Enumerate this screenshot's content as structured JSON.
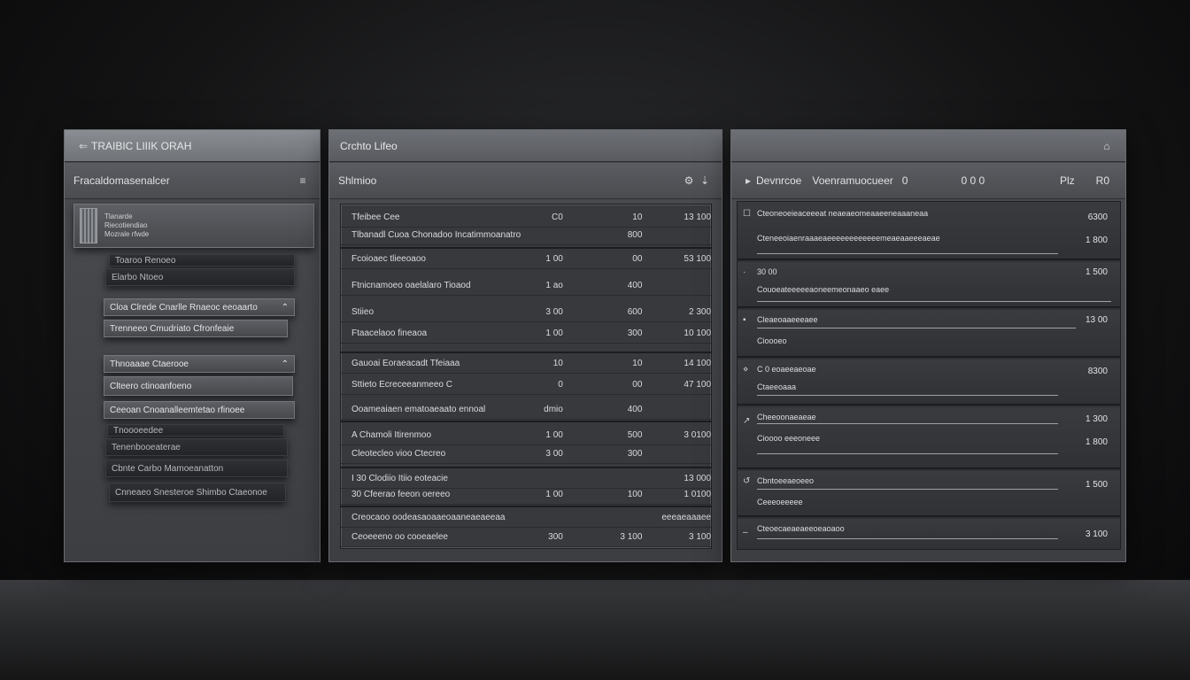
{
  "left": {
    "title": "TRAIBIC LIIIK ORAH",
    "header": "Fracaldomasenalcer",
    "cards": [
      {
        "l1": "Tlanarde",
        "l2": "Riecotiendiao",
        "l3": "Mozrale rfwde"
      },
      {
        "label": "Toaroo Renoeo"
      },
      {
        "label": "Elarbo Ntoeo"
      },
      {
        "label": "Cloa Clrede Cnarlle Rnaeoc eeoaarto"
      },
      {
        "label": "Trenneeo Cmudriato Cfronfeaie"
      },
      {
        "label": "Thnoaaae Ctaerooe"
      },
      {
        "label": "Clteero ctinoanfoeno"
      },
      {
        "label": "Ceeoan Cnoanalleemtetao rfinoee"
      },
      {
        "label": "Tnoooeedee"
      },
      {
        "label": "Tenenbooeaterae"
      },
      {
        "label": "Cbnte Carbo Mamoeanatton"
      },
      {
        "label": "Cnneaeo Snesteroe Shimbo Ctaeonoe"
      }
    ]
  },
  "mid": {
    "title": "Crchto Lifeo",
    "header": "Shlmioo",
    "groups": [
      {
        "rows": [
          {
            "a": "Tfeibee Cee",
            "b": "C0",
            "c": "10",
            "d": "13 100"
          },
          {
            "a": "Tlbanadl Cuoa Chonadoo Incatimmoanatro",
            "b": "",
            "c": "800",
            "d": ""
          }
        ]
      },
      {
        "rows": [
          {
            "a": "Fcoioaec tlieeoaoo",
            "b": "1 00",
            "c": "00",
            "d": "53 100"
          },
          {
            "a": "Ftnicnamoeo oaelalaro Tioaod",
            "b": "1 ao",
            "c": "400",
            "d": ""
          },
          {
            "a": "Stiieo",
            "b": "3 00",
            "c": "600",
            "d": "2 300"
          },
          {
            "a": "Ftaacelaoo fineaoa",
            "b": "1 00",
            "c": "300",
            "d": "10 100"
          }
        ]
      },
      {
        "rows": [
          {
            "a": "Gauoai Eoraeacadt Tfeiaaa",
            "b": "10",
            "c": "10",
            "d": "14 100"
          },
          {
            "a": "Sttieto Ecreceeanmeeo C",
            "b": "0",
            "c": "00",
            "d": "47 100"
          },
          {
            "a": "Ooameaiaen ematoaeaato ennoal",
            "b": "dmio",
            "c": "400",
            "d": ""
          }
        ]
      },
      {
        "rows": [
          {
            "a": "A Chamoli Itirenmoo",
            "b": "1 00",
            "c": "500",
            "d": "3 0100"
          },
          {
            "a": "Cleotecleo vioo Ctecreo",
            "b": "3 00",
            "c": "300",
            "d": ""
          }
        ]
      },
      {
        "rows": [
          {
            "a": "I 30 Clodiio Itiio eoteacie",
            "b": "",
            "c": "",
            "d": "13 000"
          },
          {
            "a": "30 Cfeerao feeon oereeo",
            "b": "1 00",
            "c": "100",
            "d": "1 0100"
          }
        ]
      },
      {
        "rows": [
          {
            "a": "Creocaoo oodeasaoaaeoaaneaeaeeaa",
            "b": "",
            "c": "",
            "d": "eeeaeaaaee"
          },
          {
            "a": "Ceoeeeno oo cooeaelee",
            "b": "300",
            "c": "3 100",
            "d": "3 100"
          }
        ]
      }
    ]
  },
  "right": {
    "header_items": [
      "Devnrcoe",
      "Voenramuocueer",
      "0",
      "0 0 0",
      "Plz",
      "R0"
    ],
    "items": [
      {
        "title": "Cteoneoeieaceeeat neaeaeomeaaeeneaaaneaa",
        "sub": "Cteneeoiaenraaaeaeeeeeeeeeeeemeaeaaeeeaeae",
        "v1": "6300",
        "v2": "1 800"
      },
      {
        "title": "30 00",
        "sub": "Couoeateeeeeaoneemeonaaeo eaee",
        "v1": "1 500",
        "v2": ""
      },
      {
        "title": "Cleaeoaaeeeaee",
        "sub": "Cioooeo",
        "v1": "13 00",
        "v2": ""
      },
      {
        "title": "C 0 eoaeeaeoae",
        "sub": "Ctaeeoaaa",
        "v1": "8300",
        "v2": ""
      },
      {
        "title": "Cheeoonaeaeae",
        "sub": "Cioooo eeeoneee",
        "v1": "1 300",
        "v2": "1 800"
      },
      {
        "title": "Cbntoeeaeoeeo",
        "sub": "Ceeeoeeeee",
        "v1": "1 500",
        "v2": ""
      },
      {
        "title": "Cteoecaeaeaeeoeaoaoo",
        "sub": "",
        "v1": "3 100",
        "v2": ""
      }
    ]
  }
}
